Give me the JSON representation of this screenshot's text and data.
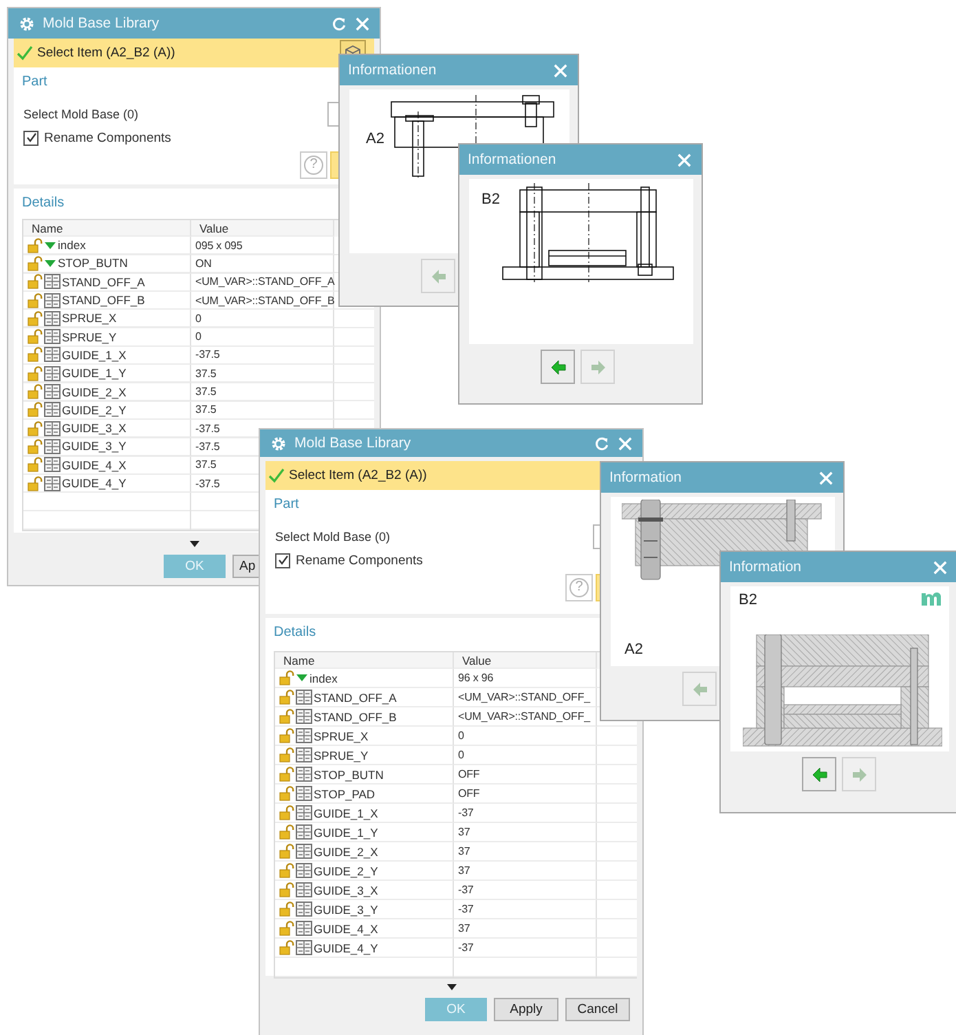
{
  "windows": [
    {
      "kind": "library",
      "title": "Mold Base Library",
      "select_item": "Select Item (A2_B2 (A))",
      "part_heading": "Part",
      "select_mold_base": "Select Mold Base (0)",
      "rename_components": {
        "label": "Rename Components",
        "checked": true
      },
      "help": "?",
      "details_heading": "Details",
      "columns": [
        "Name",
        "Value"
      ],
      "rows": [
        {
          "kind": "option",
          "name": "index",
          "value": "095 x 095"
        },
        {
          "kind": "option",
          "name": "STOP_BUTN",
          "value": "ON"
        },
        {
          "kind": "expression",
          "name": "STAND_OFF_A",
          "value": "<UM_VAR>::STAND_OFF_A"
        },
        {
          "kind": "expression",
          "name": "STAND_OFF_B",
          "value": "<UM_VAR>::STAND_OFF_B"
        },
        {
          "kind": "expression",
          "name": "SPRUE_X",
          "value": "0"
        },
        {
          "kind": "expression",
          "name": "SPRUE_Y",
          "value": "0"
        },
        {
          "kind": "expression",
          "name": "GUIDE_1_X",
          "value": "-37.5"
        },
        {
          "kind": "expression",
          "name": "GUIDE_1_Y",
          "value": "37.5"
        },
        {
          "kind": "expression",
          "name": "GUIDE_2_X",
          "value": "37.5"
        },
        {
          "kind": "expression",
          "name": "GUIDE_2_Y",
          "value": "37.5"
        },
        {
          "kind": "expression",
          "name": "GUIDE_3_X",
          "value": "-37.5"
        },
        {
          "kind": "expression",
          "name": "GUIDE_3_Y",
          "value": "-37.5"
        },
        {
          "kind": "expression",
          "name": "GUIDE_4_X",
          "value": "37.5"
        },
        {
          "kind": "expression",
          "name": "GUIDE_4_Y",
          "value": "-37.5"
        }
      ],
      "buttons": [
        {
          "kind": "default",
          "label": "OK"
        },
        {
          "kind": "normal",
          "label": "Ap"
        }
      ]
    },
    {
      "kind": "info",
      "title": "Informationen",
      "label": "A2",
      "buttons": [
        {
          "kind": "back",
          "disabled": true
        }
      ]
    },
    {
      "kind": "info",
      "title": "Informationen",
      "label": "B2",
      "buttons": [
        {
          "kind": "back",
          "disabled": false
        },
        {
          "kind": "forward",
          "disabled": true
        }
      ]
    },
    {
      "kind": "library",
      "title": "Mold Base Library",
      "select_item": "Select Item (A2_B2 (A))",
      "part_heading": "Part",
      "select_mold_base": "Select Mold Base (0)",
      "rename_components": {
        "label": "Rename Components",
        "checked": true
      },
      "help": "?",
      "details_heading": "Details",
      "columns": [
        "Name",
        "Value"
      ],
      "rows": [
        {
          "kind": "option",
          "name": "index",
          "value": "96 x 96"
        },
        {
          "kind": "expression",
          "name": "STAND_OFF_A",
          "value": "<UM_VAR>::STAND_OFF_"
        },
        {
          "kind": "expression",
          "name": "STAND_OFF_B",
          "value": "<UM_VAR>::STAND_OFF_"
        },
        {
          "kind": "expression",
          "name": "SPRUE_X",
          "value": "0"
        },
        {
          "kind": "expression",
          "name": "SPRUE_Y",
          "value": "0"
        },
        {
          "kind": "expression",
          "name": "STOP_BUTN",
          "value": "OFF"
        },
        {
          "kind": "expression",
          "name": "STOP_PAD",
          "value": "OFF"
        },
        {
          "kind": "expression",
          "name": "GUIDE_1_X",
          "value": "-37"
        },
        {
          "kind": "expression",
          "name": "GUIDE_1_Y",
          "value": "37"
        },
        {
          "kind": "expression",
          "name": "GUIDE_2_X",
          "value": "37"
        },
        {
          "kind": "expression",
          "name": "GUIDE_2_Y",
          "value": "37"
        },
        {
          "kind": "expression",
          "name": "GUIDE_3_X",
          "value": "-37"
        },
        {
          "kind": "expression",
          "name": "GUIDE_3_Y",
          "value": "-37"
        },
        {
          "kind": "expression",
          "name": "GUIDE_4_X",
          "value": "37"
        },
        {
          "kind": "expression",
          "name": "GUIDE_4_Y",
          "value": "-37"
        }
      ],
      "buttons": [
        {
          "kind": "default",
          "label": "OK"
        },
        {
          "kind": "normal",
          "label": "Apply"
        },
        {
          "kind": "normal",
          "label": "Cancel"
        }
      ]
    },
    {
      "kind": "info",
      "title": "Information",
      "label": "A2",
      "buttons": [
        {
          "kind": "back",
          "disabled": true
        }
      ]
    },
    {
      "kind": "info",
      "title": "Information",
      "label": "B2",
      "buttons": [
        {
          "kind": "back",
          "disabled": false
        },
        {
          "kind": "forward",
          "disabled": true
        }
      ]
    }
  ]
}
